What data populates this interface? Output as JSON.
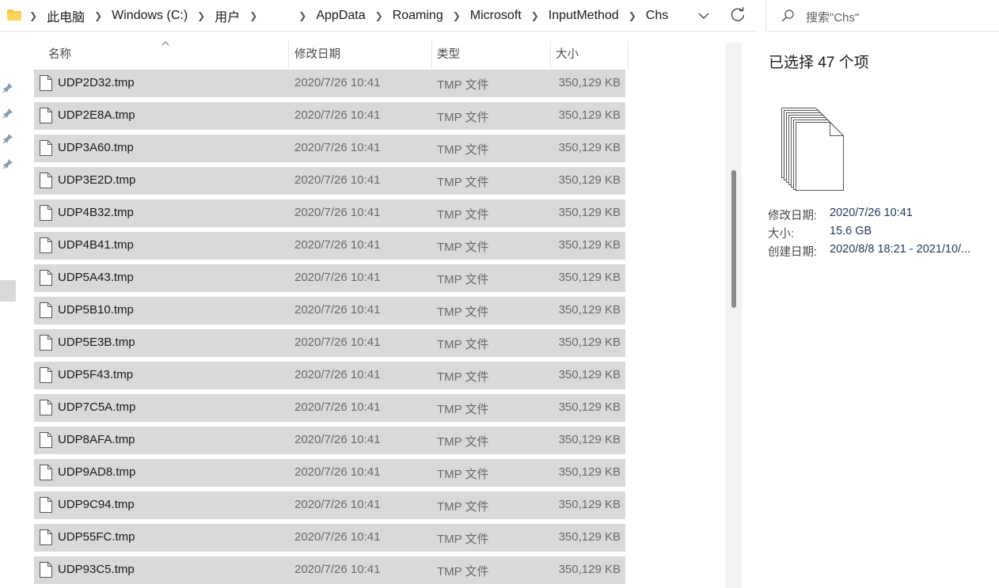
{
  "address": {
    "crumbs": [
      "此电脑",
      "Windows (C:)",
      "用户",
      "AppData",
      "Roaming",
      "Microsoft",
      "InputMethod",
      "Chs"
    ]
  },
  "search": {
    "placeholder": "搜索\"Chs\""
  },
  "columns": {
    "name": "名称",
    "date": "修改日期",
    "type": "类型",
    "size": "大小"
  },
  "files": [
    {
      "name": "UDP2D32.tmp",
      "date": "2020/7/26 10:41",
      "type": "TMP 文件",
      "size": "350,129 KB"
    },
    {
      "name": "UDP2E8A.tmp",
      "date": "2020/7/26 10:41",
      "type": "TMP 文件",
      "size": "350,129 KB"
    },
    {
      "name": "UDP3A60.tmp",
      "date": "2020/7/26 10:41",
      "type": "TMP 文件",
      "size": "350,129 KB"
    },
    {
      "name": "UDP3E2D.tmp",
      "date": "2020/7/26 10:41",
      "type": "TMP 文件",
      "size": "350,129 KB"
    },
    {
      "name": "UDP4B32.tmp",
      "date": "2020/7/26 10:41",
      "type": "TMP 文件",
      "size": "350,129 KB"
    },
    {
      "name": "UDP4B41.tmp",
      "date": "2020/7/26 10:41",
      "type": "TMP 文件",
      "size": "350,129 KB"
    },
    {
      "name": "UDP5A43.tmp",
      "date": "2020/7/26 10:41",
      "type": "TMP 文件",
      "size": "350,129 KB"
    },
    {
      "name": "UDP5B10.tmp",
      "date": "2020/7/26 10:41",
      "type": "TMP 文件",
      "size": "350,129 KB"
    },
    {
      "name": "UDP5E3B.tmp",
      "date": "2020/7/26 10:41",
      "type": "TMP 文件",
      "size": "350,129 KB"
    },
    {
      "name": "UDP5F43.tmp",
      "date": "2020/7/26 10:41",
      "type": "TMP 文件",
      "size": "350,129 KB"
    },
    {
      "name": "UDP7C5A.tmp",
      "date": "2020/7/26 10:41",
      "type": "TMP 文件",
      "size": "350,129 KB"
    },
    {
      "name": "UDP8AFA.tmp",
      "date": "2020/7/26 10:41",
      "type": "TMP 文件",
      "size": "350,129 KB"
    },
    {
      "name": "UDP9AD8.tmp",
      "date": "2020/7/26 10:41",
      "type": "TMP 文件",
      "size": "350,129 KB"
    },
    {
      "name": "UDP9C94.tmp",
      "date": "2020/7/26 10:41",
      "type": "TMP 文件",
      "size": "350,129 KB"
    },
    {
      "name": "UDP55FC.tmp",
      "date": "2020/7/26 10:41",
      "type": "TMP 文件",
      "size": "350,129 KB"
    },
    {
      "name": "UDP93C5.tmp",
      "date": "2020/7/26 10:41",
      "type": "TMP 文件",
      "size": "350,129 KB"
    }
  ],
  "details": {
    "title": "已选择 47 个项",
    "modified_label": "修改日期:",
    "modified_value": "2020/7/26 10:41",
    "size_label": "大小:",
    "size_value": "15.6 GB",
    "created_label": "创建日期:",
    "created_value": "2020/8/8 18:21 - 2021/10/..."
  },
  "colors": {
    "selection": "#d9d9d9",
    "folder": "#f5c242",
    "accent": "#1f3a5a"
  }
}
